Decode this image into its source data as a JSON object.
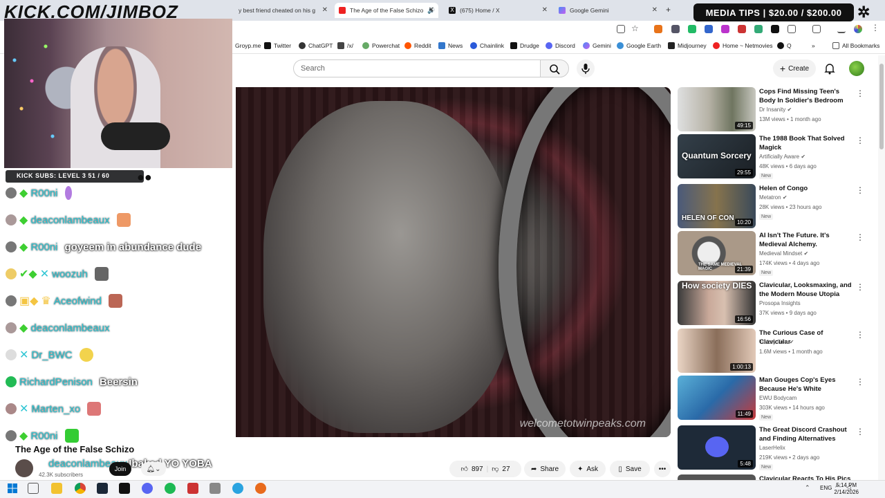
{
  "browser": {
    "tabs": [
      {
        "label": "y best friend cheated on his g"
      },
      {
        "label": "The Age of the False Schizo"
      },
      {
        "label": "(675) Home / X"
      },
      {
        "label": "Google Gemini"
      }
    ],
    "new_tab": "+",
    "bookmarks": [
      "Groyp.me",
      "Twitter",
      "ChatGPT",
      "/x/",
      "Powerchat",
      "Reddit",
      "News",
      "Chainlink",
      "Drudge",
      "Discord",
      "Gemini",
      "Google Earth",
      "Midjourney",
      "Home ~ Netmovies",
      "Q"
    ],
    "all_bookmarks": "All Bookmarks",
    "overflow": "»"
  },
  "overlay": {
    "watermark": "KICK.COM/JIMBOZ",
    "media_tips": "MEDIA TIPS | $20.00 / $200.00",
    "subs_bar": "KICK SUBS: LEVEL 3 51 / 60"
  },
  "youtube": {
    "search_placeholder": "Search",
    "create_label": "Create",
    "video_watermark": "welcometotwinpeaks.com",
    "video_title": "The Age of the False Schizo",
    "subscribers": "42.3K subscribers",
    "join_label": "Join",
    "likes": "897",
    "dislikes": "27",
    "share_label": "Share",
    "ask_label": "Ask",
    "save_label": "Save",
    "more_label": "•••"
  },
  "chat": [
    {
      "user": "R00ni",
      "msg": ""
    },
    {
      "user": "deaconlambeaux",
      "msg": ""
    },
    {
      "user": "R00ni",
      "msg": "goyeem in abundance dude"
    },
    {
      "user": "woozuh",
      "msg": ""
    },
    {
      "user": "Aceofwind",
      "msg": ""
    },
    {
      "user": "deaconlambeaux",
      "msg": ""
    },
    {
      "user": "Dr_BWC",
      "msg": ""
    },
    {
      "user": "RichardPenison",
      "msg": "Beersin"
    },
    {
      "user": "Marten_xo",
      "msg": ""
    },
    {
      "user": "R00ni",
      "msg": ""
    },
    {
      "user": "deaconlambeaux",
      "msg": "Ibaked YO YOBA"
    }
  ],
  "recommendations": [
    {
      "title": "Cops Find Missing Teen's Body In Soldier's Bedroom",
      "channel": "Dr Insanity",
      "meta": "13M views • 1 month ago",
      "duration": "49:15",
      "new": ""
    },
    {
      "title": "The 1988 Book That Solved Magick",
      "channel": "Artificially Aware",
      "meta": "48K views • 6 days ago",
      "duration": "29:55",
      "new": "New",
      "thumb_text": "Quantum Sorcery"
    },
    {
      "title": "Helen of Congo",
      "channel": "Metatron",
      "meta": "28K views • 23 hours ago",
      "duration": "10:20",
      "new": "New",
      "thumb_text": "HELEN OF CON"
    },
    {
      "title": "AI Isn't The Future. It's Medieval Alchemy.",
      "channel": "Medieval Mindset",
      "meta": "174K views • 4 days ago",
      "duration": "21:39",
      "new": "New",
      "thumb_text": "THE SAME MEDIEVAL MAGIC"
    },
    {
      "title": "Clavicular, Looksmaxing, and the Modern Mouse Utopia",
      "channel": "Prosopa Insights",
      "meta": "37K views • 9 days ago",
      "duration": "16:56",
      "new": "",
      "thumb_text": "How society DIES"
    },
    {
      "title": "The Curious Case of Clavicular",
      "channel": "Turkey Tom",
      "meta": "1.6M views • 1 month ago",
      "duration": "1:00:13",
      "new": ""
    },
    {
      "title": "Man Gouges Cop's Eyes Because He's White",
      "channel": "EWU Bodycam",
      "meta": "303K views • 14 hours ago",
      "duration": "11:49",
      "new": "New"
    },
    {
      "title": "The Great Discord Crashout and Finding Alternatives",
      "channel": "LaserHelix",
      "meta": "219K views • 2 days ago",
      "duration": "5:48",
      "new": "New"
    },
    {
      "title": "Clavicular Reacts To His Pics",
      "channel": "",
      "meta": "",
      "duration": "",
      "new": ""
    }
  ],
  "taskbar": {
    "lang": "ENG",
    "time": "5:14 PM",
    "date": "2/14/2026"
  }
}
